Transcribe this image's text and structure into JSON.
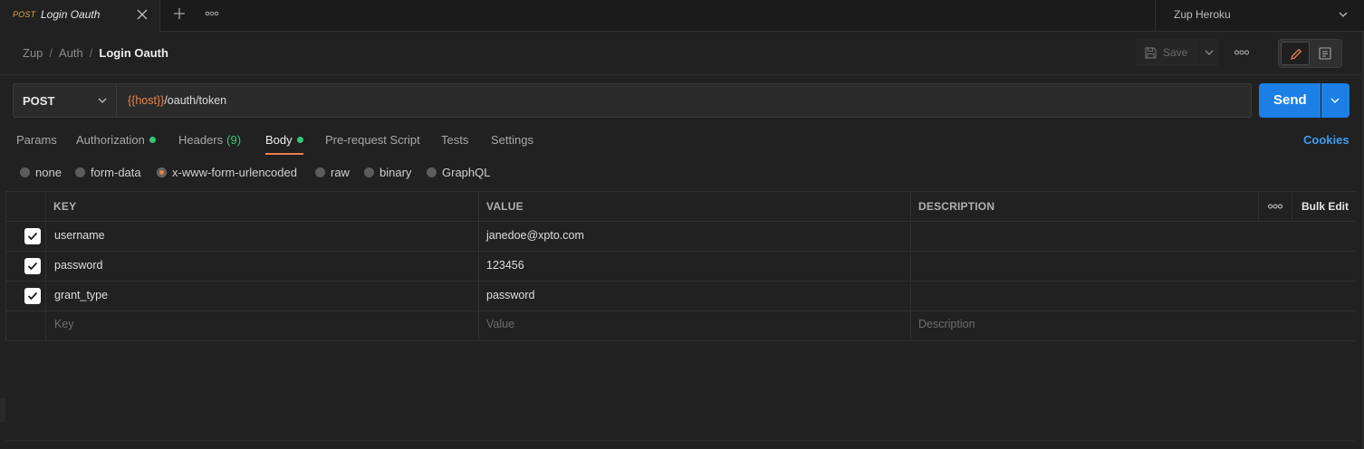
{
  "tab": {
    "method": "POST",
    "title": "Login Oauth"
  },
  "environment": {
    "label": "Zup Heroku"
  },
  "breadcrumb": {
    "items": [
      "Zup",
      "Auth"
    ],
    "current": "Login Oauth"
  },
  "toolbar": {
    "save_label": "Save"
  },
  "request": {
    "method": "POST",
    "url_variable": "{{host}}",
    "url_path": "/oauth/token",
    "send_label": "Send"
  },
  "request_tabs": {
    "params": "Params",
    "authorization": "Authorization",
    "headers": "Headers",
    "headers_count": "(9)",
    "body": "Body",
    "prerequest": "Pre-request Script",
    "tests": "Tests",
    "settings": "Settings",
    "cookies": "Cookies"
  },
  "body_types": {
    "none": "none",
    "form_data": "form-data",
    "urlencoded": "x-www-form-urlencoded",
    "raw": "raw",
    "binary": "binary",
    "graphql": "GraphQL",
    "selected": "x-www-form-urlencoded"
  },
  "table": {
    "headers": {
      "key": "KEY",
      "value": "VALUE",
      "description": "DESCRIPTION",
      "bulk_edit": "Bulk Edit"
    },
    "rows": [
      {
        "checked": true,
        "key": "username",
        "value": "janedoe@xpto.com",
        "description": ""
      },
      {
        "checked": true,
        "key": "password",
        "value": "123456",
        "description": ""
      },
      {
        "checked": true,
        "key": "grant_type",
        "value": "password",
        "description": ""
      }
    ],
    "placeholders": {
      "key": "Key",
      "value": "Value",
      "description": "Description"
    }
  },
  "colors": {
    "accent_orange": "#e8824c",
    "send_blue": "#1b7fe6",
    "status_green": "#34c779",
    "method_yellow": "#e0a53f"
  }
}
